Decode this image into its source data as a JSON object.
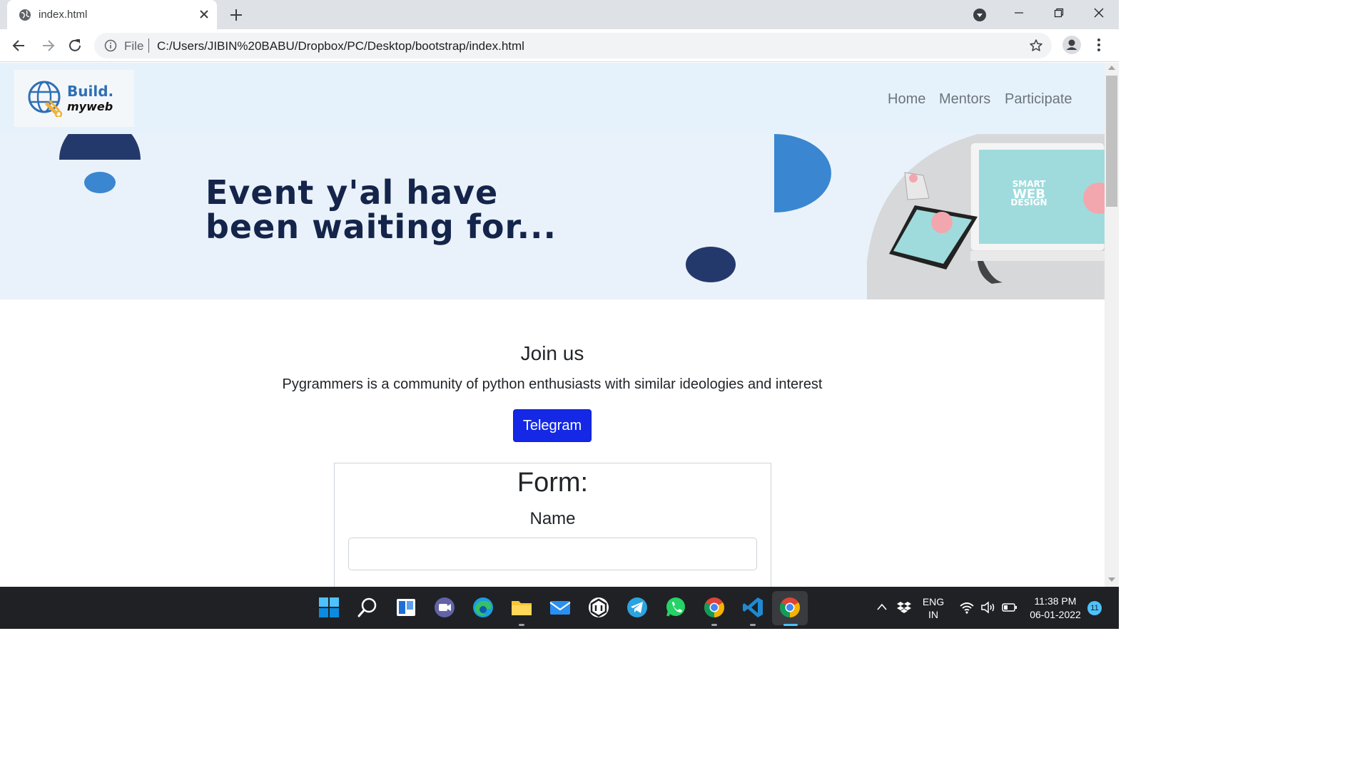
{
  "browser": {
    "tab_title": "index.html",
    "scheme_label": "File",
    "url": "C:/Users/JIBIN%20BABU/Dropbox/PC/Desktop/bootstrap/index.html"
  },
  "site": {
    "logo": {
      "line1": "Build.",
      "line2": "myweb"
    },
    "nav": [
      {
        "label": "Home"
      },
      {
        "label": "Mentors"
      },
      {
        "label": "Participate"
      }
    ],
    "hero": {
      "line1": "Event y'al have",
      "line2": "been waiting for...",
      "device_text": [
        "SMART",
        "WEB",
        "DESIGN"
      ]
    },
    "join": {
      "title": "Join us",
      "text": "Pygrammers is a community of python enthusiasts with similar ideologies and interest",
      "button": "Telegram"
    },
    "form": {
      "title": "Form:",
      "name_label": "Name",
      "name_value": ""
    }
  },
  "taskbar": {
    "apps": [
      "start-icon",
      "search-icon",
      "task-view-icon",
      "teams-chat-icon",
      "edge-icon",
      "file-explorer-icon",
      "mail-icon",
      "app-icon",
      "telegram-icon",
      "whatsapp-icon",
      "chrome-icon",
      "vscode-icon",
      "chrome-active-icon"
    ],
    "language": "ENG",
    "region": "IN",
    "time": "11:38 PM",
    "date": "06-01-2022",
    "notification_count": "11"
  },
  "colors": {
    "nav_bg": "#e6f2fb",
    "hero_bg": "#e9f2fa",
    "hero_navy": "#14244a",
    "accent_blue": "#3a86d0",
    "telegram_button": "#1428e6"
  }
}
